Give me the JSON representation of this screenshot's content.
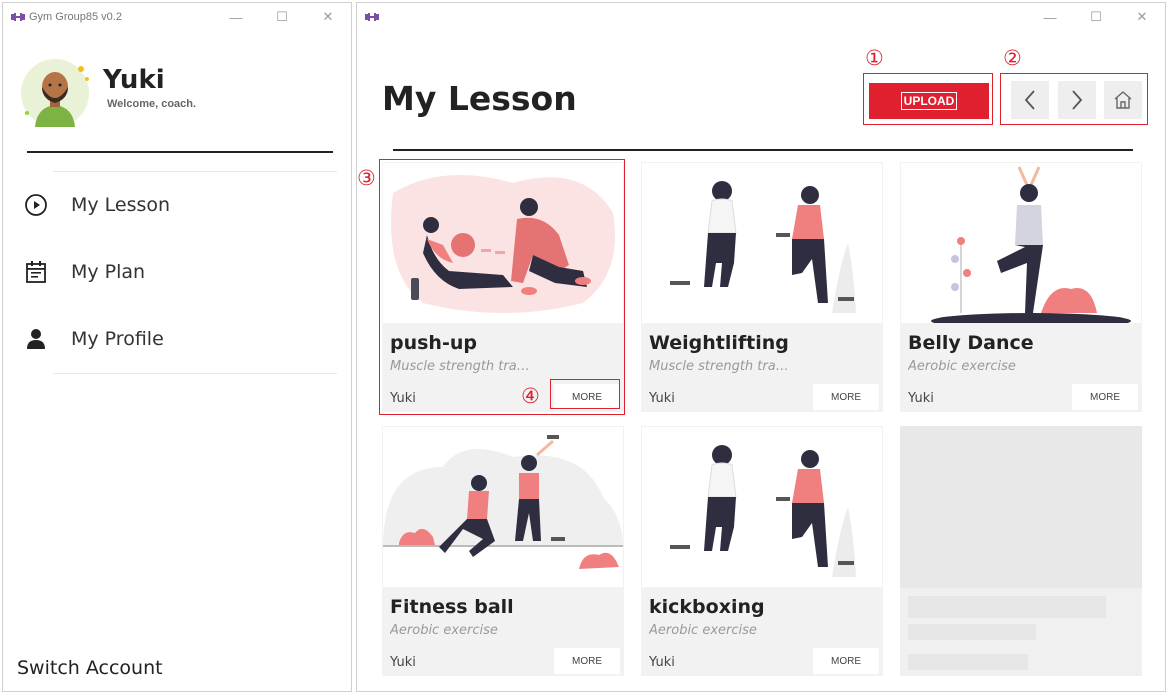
{
  "left_window": {
    "title": "Gym Group85 v0.2",
    "controls": {
      "minimize": "—",
      "maximize": "☐",
      "close": "✕"
    }
  },
  "user": {
    "name": "Yuki",
    "subtitle": "Welcome, coach."
  },
  "menu": {
    "items": [
      {
        "label": "My Lesson",
        "icon": "play-circle-icon"
      },
      {
        "label": "My Plan",
        "icon": "calendar-icon"
      },
      {
        "label": "My Profile",
        "icon": "person-icon"
      }
    ]
  },
  "switch_account": "Switch Account",
  "right_window": {
    "controls": {
      "minimize": "—",
      "maximize": "☐",
      "close": "✕"
    }
  },
  "page_title": "My Lesson",
  "toolbar": {
    "upload_label": "UPLOAD",
    "back_icon": "chevron-left-icon",
    "forward_icon": "chevron-right-icon",
    "home_icon": "home-icon"
  },
  "annotations": [
    "①",
    "②",
    "③",
    "④"
  ],
  "lessons": [
    {
      "title": "push-up",
      "description": "Muscle strength trai...",
      "author": "Yuki",
      "more": "MORE"
    },
    {
      "title": "Weightlifting",
      "description": "Muscle strength trai...",
      "author": "Yuki",
      "more": "MORE"
    },
    {
      "title": "Belly Dance",
      "description": "Aerobic exercise",
      "author": "Yuki",
      "more": "MORE"
    },
    {
      "title": "Fitness ball",
      "description": "Aerobic exercise",
      "author": "Yuki",
      "more": "MORE"
    },
    {
      "title": "kickboxing",
      "description": "Aerobic exercise",
      "author": "Yuki",
      "more": "MORE"
    }
  ],
  "colors": {
    "accent": "#e0202e",
    "logo": "#7b4fa8",
    "illustration_pink": "#f08080",
    "illustration_dark": "#2f2e41"
  }
}
